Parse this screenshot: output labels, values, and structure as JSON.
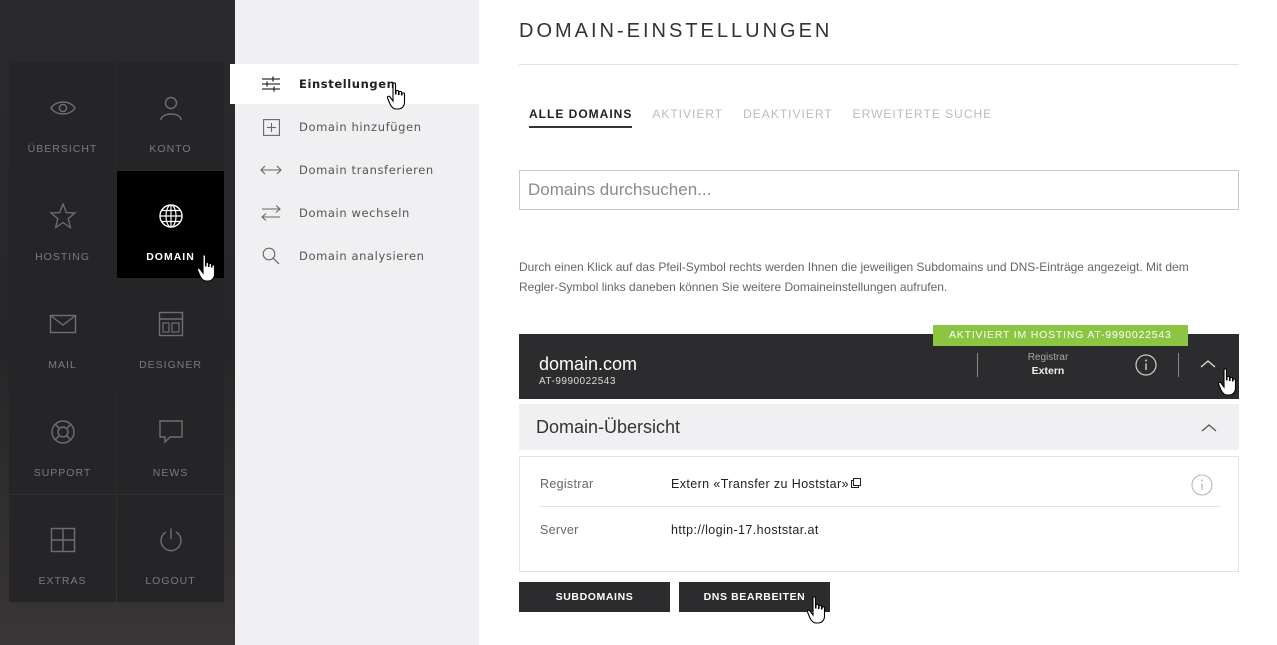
{
  "nav": {
    "tiles": [
      {
        "label": "ÜBERSICHT",
        "icon": "eye-icon"
      },
      {
        "label": "KONTO",
        "icon": "user-icon"
      },
      {
        "label": "HOSTING",
        "icon": "star-icon"
      },
      {
        "label": "DOMAIN",
        "icon": "globe-icon",
        "active": true
      },
      {
        "label": "MAIL",
        "icon": "envelope-icon"
      },
      {
        "label": "DESIGNER",
        "icon": "layout-icon"
      },
      {
        "label": "SUPPORT",
        "icon": "lifebuoy-icon"
      },
      {
        "label": "NEWS",
        "icon": "speech-bubble-icon"
      },
      {
        "label": "EXTRAS",
        "icon": "plus-box-icon"
      },
      {
        "label": "LOGOUT",
        "icon": "power-icon"
      }
    ]
  },
  "submenu": {
    "items": [
      {
        "label": "Einstellungen",
        "icon": "sliders-icon",
        "active": true
      },
      {
        "label": "Domain hinzufügen",
        "icon": "plus-square-icon"
      },
      {
        "label": "Domain transferieren",
        "icon": "double-arrow-icon"
      },
      {
        "label": "Domain wechseln",
        "icon": "swap-arrows-icon"
      },
      {
        "label": "Domain analysieren",
        "icon": "magnifier-icon"
      }
    ]
  },
  "main": {
    "title": "DOMAIN-EINSTELLUNGEN",
    "tabs": [
      {
        "label": "ALLE DOMAINS",
        "active": true
      },
      {
        "label": "AKTIVIERT"
      },
      {
        "label": "DEAKTIVIERT"
      },
      {
        "label": "ERWEITERTE SUCHE"
      }
    ],
    "search_placeholder": "Domains durchsuchen...",
    "info_text": "Durch einen Klick auf das Pfeil-Symbol rechts werden Ihnen die jeweiligen Subdomains und DNS-Einträge angezeigt. Mit dem Regler-Symbol links daneben können Sie weitere Domaineinstellungen aufrufen.",
    "domain": {
      "badge": "AKTIVIERT IM HOSTING AT-9990022543",
      "name": "domain.com",
      "id": "AT-9990022543",
      "registrar_label": "Registrar",
      "registrar_value": "Extern"
    },
    "overview": {
      "title": "Domain-Übersicht",
      "rows": [
        {
          "label": "Registrar",
          "value": "Extern «Transfer zu Hoststar»"
        },
        {
          "label": "Server",
          "value": "http://login-17.hoststar.at"
        }
      ]
    },
    "buttons": {
      "subdomains": "SUBDOMAINS",
      "dns": "DNS BEARBEITEN"
    }
  },
  "colors": {
    "accent_green": "#8cc542",
    "dark_bar": "#2c2c2e",
    "nav_bg": "#252527"
  }
}
